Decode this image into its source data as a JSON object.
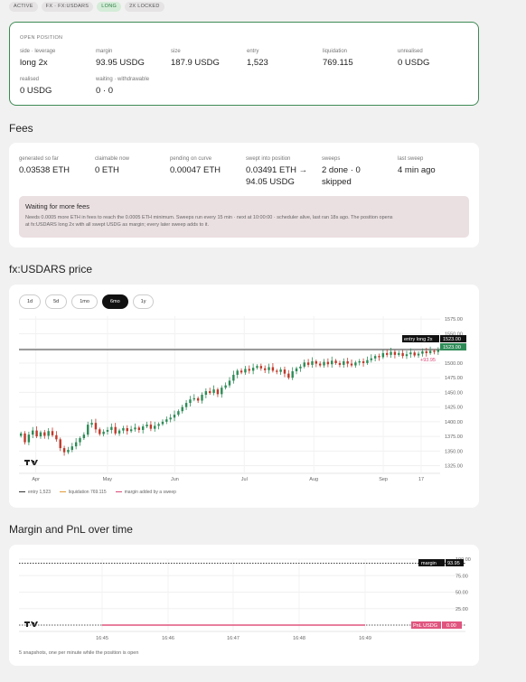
{
  "pills": [
    "ACTIVE",
    "FX · FX:USDARS",
    "LONG",
    "2X LOCKED"
  ],
  "open_position": {
    "eyebrow": "OPEN POSITION",
    "stats": [
      {
        "label": "side · leverage",
        "value": "long 2x"
      },
      {
        "label": "margin",
        "value": "93.95 USDG"
      },
      {
        "label": "size",
        "value": "187.9 USDG"
      },
      {
        "label": "entry",
        "value": "1,523"
      },
      {
        "label": "liquidation",
        "value": "769.115"
      },
      {
        "label": "unrealised",
        "value": "0 USDG"
      },
      {
        "label": "realised",
        "value": "0 USDG"
      },
      {
        "label": "waiting · withdrawable",
        "value": "0 · 0"
      }
    ]
  },
  "fees": {
    "title": "Fees",
    "stats": [
      {
        "label": "generated so far",
        "value": "0.03538 ETH"
      },
      {
        "label": "claimable now",
        "value": "0 ETH"
      },
      {
        "label": "pending on curve",
        "value": "0.00047 ETH"
      },
      {
        "label": "swept into position",
        "value": "0.03491 ETH →",
        "value2": "94.05 USDG"
      },
      {
        "label": "sweeps",
        "value": "2 done · 0",
        "value2": "skipped"
      },
      {
        "label": "last sweep",
        "value": "4 min ago"
      }
    ],
    "notice_title": "Waiting for more fees",
    "notice_body_1": "Needs 0.0005 more ETH in fees to reach the 0.0005 ETH minimum. Sweeps run every 15 min · next at 10:00:00 · scheduler alive, last ran 18s ago. The position opens",
    "notice_body_2": "at fx:USDARS long 2x with all swept USDG as margin; every later sweep adds to it."
  },
  "price": {
    "title": "fx:USDARS price",
    "timeframes": [
      "1d",
      "5d",
      "1mo",
      "6mo",
      "1y"
    ],
    "active_timeframe": "6mo",
    "entry_tag": "entry long 2x",
    "entry_value": "1523.00",
    "last_value": "1523.00",
    "delta_label": "+93.95",
    "legend": [
      "entry 1,523",
      "liquidation 769.115",
      "margin added by a sweep"
    ],
    "colors": {
      "up": "#2e8b57",
      "down": "#c0392b",
      "entry": "#3b3b3b"
    },
    "chart_data": {
      "type": "candlestick",
      "ylim": [
        1312,
        1580
      ],
      "yticks": [
        1575,
        1550,
        1525,
        1500,
        1475,
        1450,
        1425,
        1400,
        1375,
        1350,
        1325
      ],
      "ytick_labels": [
        "1575.00",
        "1550.00",
        "1525.00",
        "1500.00",
        "1475.00",
        "1450.00",
        "1425.00",
        "1400.00",
        "1375.00",
        "1350.00",
        "1325.00"
      ],
      "xtick_labels": [
        "Apr",
        "May",
        "Jun",
        "Jul",
        "Aug",
        "Sep",
        "17"
      ],
      "entry": 1523,
      "close": [
        1380,
        1365,
        1378,
        1385,
        1375,
        1382,
        1376,
        1384,
        1377,
        1370,
        1355,
        1348,
        1352,
        1358,
        1365,
        1372,
        1378,
        1395,
        1398,
        1387,
        1379,
        1383,
        1386,
        1391,
        1380,
        1385,
        1389,
        1384,
        1387,
        1390,
        1386,
        1392,
        1395,
        1388,
        1393,
        1396,
        1400,
        1404,
        1407,
        1412,
        1418,
        1425,
        1432,
        1438,
        1440,
        1436,
        1446,
        1452,
        1449,
        1455,
        1447,
        1458,
        1462,
        1470,
        1480,
        1487,
        1484,
        1490,
        1487,
        1492,
        1495,
        1491,
        1488,
        1493,
        1487,
        1485,
        1489,
        1482,
        1475,
        1486,
        1491,
        1494,
        1501,
        1497,
        1503,
        1499,
        1496,
        1502,
        1498,
        1504,
        1500,
        1497,
        1503,
        1499,
        1496,
        1501,
        1503,
        1500,
        1505,
        1508,
        1512,
        1510,
        1517,
        1514,
        1519,
        1514,
        1517,
        1512,
        1515,
        1518,
        1513,
        1516,
        1520,
        1517,
        1521,
        1519,
        1523
      ]
    }
  },
  "pnl": {
    "title": "Margin and PnL over time",
    "margin_tag": "margin",
    "margin_value": "93.95",
    "pnl_tag": "PnL USDG",
    "pnl_value": "0.00",
    "snapshots_note": "5 snapshots, one per minute while the position is open",
    "chart_data": {
      "type": "line",
      "x": [
        "16:45",
        "16:46",
        "16:47",
        "16:48",
        "16:49"
      ],
      "ylim": [
        0,
        100
      ],
      "ytick_labels": [
        "100.00",
        "75.00",
        "50.00",
        "25.00"
      ],
      "series": [
        {
          "name": "margin",
          "values": [
            93.95,
            93.95,
            93.95,
            93.95,
            93.95
          ]
        },
        {
          "name": "PnL USDG",
          "values": [
            0,
            0,
            0,
            0,
            0
          ]
        }
      ]
    }
  }
}
